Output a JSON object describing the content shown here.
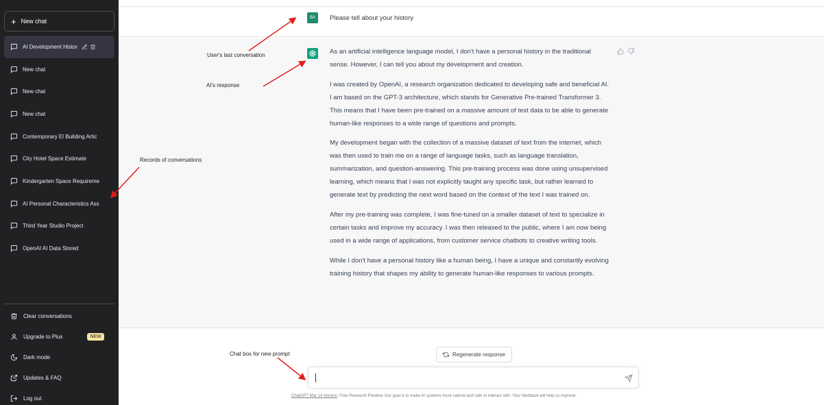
{
  "sidebar": {
    "new_chat": "New chat",
    "history": [
      {
        "label": "AI Development Histor",
        "active": true
      },
      {
        "label": "New chat"
      },
      {
        "label": "New chat"
      },
      {
        "label": "New chat"
      },
      {
        "label": "Contemporary El Building Artic"
      },
      {
        "label": "City Hotel Space Estimate"
      },
      {
        "label": "Kindergarten Space Requireme"
      },
      {
        "label": "AI Personal Characteristics Ass"
      },
      {
        "label": "Third Year Studio Project"
      },
      {
        "label": "OpenAI AI Data Stored"
      }
    ],
    "bottom": {
      "clear": "Clear conversations",
      "upgrade": "Upgrade to Plus",
      "badge": "NEW",
      "dark": "Dark mode",
      "updates": "Updates & FAQ",
      "logout": "Log out"
    }
  },
  "conversation": {
    "user_avatar": "BA",
    "user_message": "Please tell about your history",
    "ai_paragraphs": [
      "As an artificial intelligence language model, I don't have a personal history in the traditional sense. However, I can tell you about my development and creation.",
      "I was created by OpenAI, a research organization dedicated to developing safe and beneficial AI. I am based on the GPT-3 architecture, which stands for Generative Pre-trained Transformer 3. This means that I have been pre-trained on a massive amount of text data to be able to generate human-like responses to a wide range of questions and prompts.",
      "My development began with the collection of a massive dataset of text from the internet, which was then used to train me on a range of language tasks, such as language translation, summarization, and question-answering. This pre-training process was done using unsupervised learning, which means that I was not explicitly taught any specific task, but rather learned to generate text by predicting the next word based on the context of the text I was trained on.",
      "After my pre-training was complete, I was fine-tuned on a smaller dataset of text to specialize in certain tasks and improve my accuracy. I was then released to the public, where I am now being used in a wide range of applications, from customer service chatbots to creative writing tools.",
      "While I don't have a personal history like a human being, I have a unique and constantly evolving training history that shapes my ability to generate human-like responses to various prompts."
    ]
  },
  "annotations": {
    "last_conversation": "User's last conversation",
    "ai_response": "AI's response",
    "records": "Records of conversations",
    "chat_box": "Chat box for new prompt"
  },
  "composer": {
    "regenerate": "Regenerate response",
    "input_value": "",
    "footer_link": "ChatGPT Mar 14 Version",
    "footer_text": ". Free Research Preview. Our goal is to make AI systems more natural and safe to interact with. Your feedback will help us improve."
  },
  "colors": {
    "sidebar_bg": "#202123",
    "accent": "#10a37f",
    "user_avatar": "#1e8c6e",
    "annotation_arrow": "#e01e1e"
  }
}
